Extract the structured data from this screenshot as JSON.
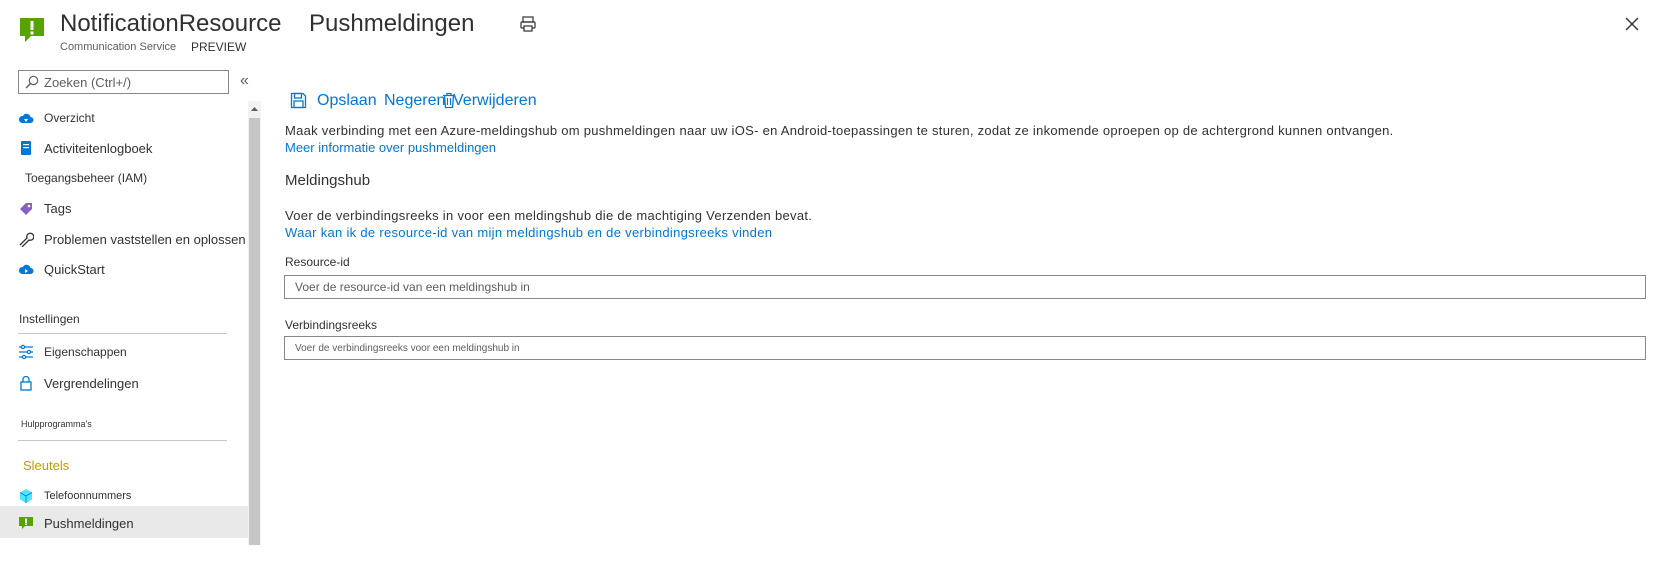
{
  "header": {
    "resource_name": "NotificationResource",
    "resource_type": "Communication Service",
    "preview_label": "PREVIEW",
    "page_title": "Pushmeldingen",
    "print_icon": "print-icon",
    "close_icon": "close-icon"
  },
  "sidebar": {
    "search_placeholder": "Zoeken (Ctrl+/)",
    "collapse_glyph": "«",
    "items": [
      {
        "label": "Overzicht",
        "icon": "overview-cloud-icon"
      },
      {
        "label": "Activiteitenlogboek",
        "icon": "activity-log-icon"
      },
      {
        "label": "Toegangsbeheer (IAM)",
        "icon": ""
      },
      {
        "label": "Tags",
        "icon": "tag-icon"
      },
      {
        "label": "Problemen vaststellen en oplossen",
        "icon": "wrench-icon"
      },
      {
        "label": "QuickStart",
        "icon": "quickstart-cloud-icon"
      }
    ],
    "section_settings": "Instellingen",
    "settings_items": [
      {
        "label": "Eigenschappen",
        "icon": "properties-icon"
      },
      {
        "label": "Vergrendelingen",
        "icon": "lock-icon"
      }
    ],
    "section_tools": "Hulpprogramma's",
    "tools_items": [
      {
        "label": "Sleutels",
        "icon": ""
      },
      {
        "label": "Telefoonnummers",
        "icon": "phone-numbers-icon"
      },
      {
        "label": "Pushmeldingen",
        "icon": "push-notification-icon"
      }
    ]
  },
  "toolbar": {
    "save_label": "Opslaan",
    "discard_label": "Negeren",
    "delete_label": "Verwijderen"
  },
  "main": {
    "description": "Maak verbinding met een Azure-meldingshub om pushmeldingen naar uw iOS- en Android-toepassingen te sturen, zodat ze inkomende oproepen op de achtergrond kunnen ontvangen.",
    "more_info_link": "Meer informatie over pushmeldingen",
    "section_heading": "Meldingshub",
    "instruction": "Voer de verbindingsreeks in voor een meldingshub die de machtiging Verzenden bevat.",
    "help_link": "Waar kan ik de resource-id van mijn meldingshub en de verbindingsreeks vinden",
    "resource_id_label": "Resource-id",
    "resource_id_placeholder": "Voer de resource-id van een meldingshub in",
    "resource_id_value": "",
    "connection_label": "Verbindingsreeks",
    "connection_placeholder": "Voer de verbindingsreeks voor een meldingshub in",
    "connection_value": ""
  },
  "colors": {
    "accent": "#0078d4",
    "resource_icon": "#57a300",
    "selected_bg": "#e9e9e9",
    "tools_link": "#c19c00"
  }
}
